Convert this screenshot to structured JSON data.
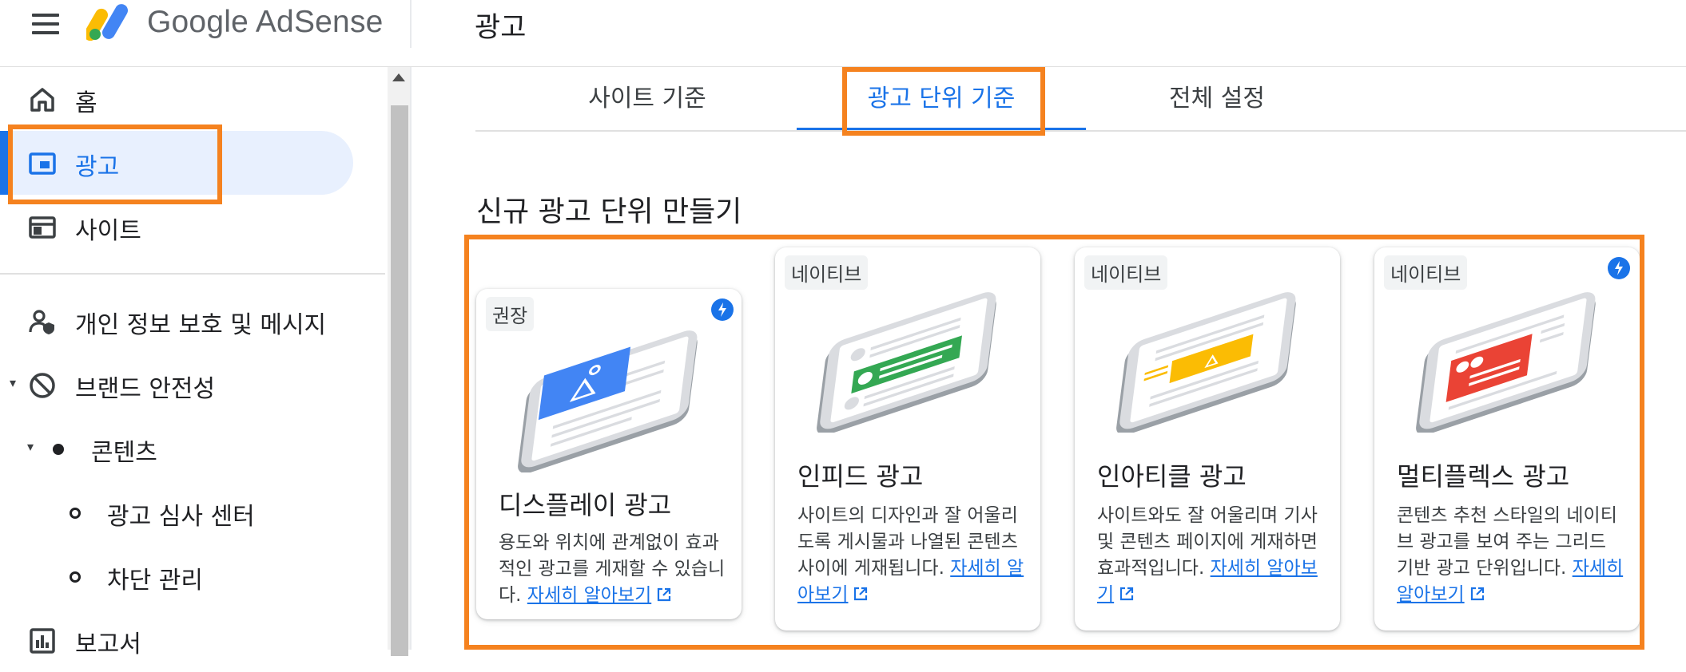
{
  "app": {
    "product_name": "Google AdSense",
    "page_title": "광고"
  },
  "sidebar": {
    "items": [
      {
        "label": "홈",
        "icon": "home-icon"
      },
      {
        "label": "광고",
        "icon": "ads-icon",
        "active": true
      },
      {
        "label": "사이트",
        "icon": "sites-icon"
      },
      {
        "label": "개인 정보 보호 및 메시지",
        "icon": "privacy-messaging-icon"
      },
      {
        "label": "브랜드 안전성",
        "icon": "brand-safety-icon"
      },
      {
        "label": "콘텐츠",
        "icon": "content-dot-icon"
      },
      {
        "label": "광고 심사 센터",
        "icon": "sub-item-circle-icon"
      },
      {
        "label": "차단 관리",
        "icon": "sub-item-circle-icon"
      },
      {
        "label": "보고서",
        "icon": "reports-icon"
      }
    ]
  },
  "tabs": [
    {
      "label": "사이트 기준"
    },
    {
      "label": "광고 단위 기준",
      "active": true
    },
    {
      "label": "전체 설정"
    }
  ],
  "section_title": "신규 광고 단위 만들기",
  "cards": [
    {
      "chip": "권장",
      "title": "디스플레이 광고",
      "description": "용도와 위치에 관계없이 효과적인 광고를 게재할 수 있습니다.",
      "link": "자세히 알아보기",
      "accent": "#4285f4",
      "bolt": true
    },
    {
      "chip": "네이티브",
      "title": "인피드 광고",
      "description": "사이트의 디자인과 잘 어울리도록 게시물과 나열된 콘텐츠 사이에 게재됩니다.",
      "link": "자세히 알아보기",
      "accent": "#34a853",
      "bolt": false
    },
    {
      "chip": "네이티브",
      "title": "인아티클 광고",
      "description": "사이트와도 잘 어울리며 기사 및 콘텐츠 페이지에 게재하면 효과적입니다.",
      "link": "자세히 알아보기",
      "accent": "#fbbc04",
      "bolt": false
    },
    {
      "chip": "네이티브",
      "title": "멀티플렉스 광고",
      "description": "콘텐츠 추천 스타일의 네이티브 광고를 보여 주는 그리드 기반 광고 단위입니다.",
      "link": "자세히 알아보기",
      "accent": "#ea4335",
      "bolt": true
    }
  ],
  "colors": {
    "primary": "#1a73e8",
    "highlight": "#f5821f",
    "active_nav_bg": "#e8f0fe"
  }
}
